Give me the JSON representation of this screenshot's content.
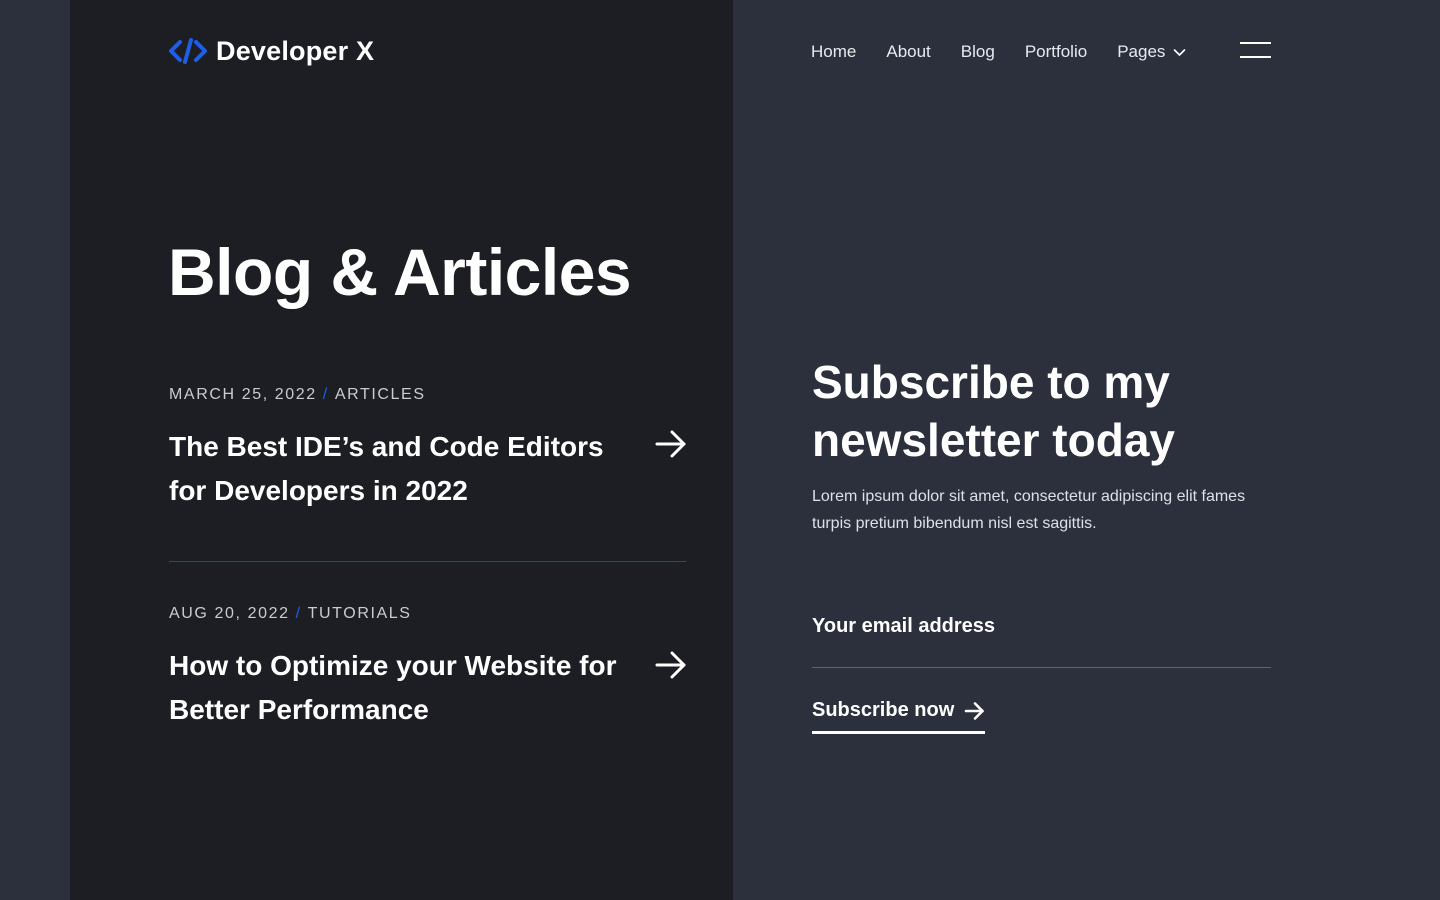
{
  "brand": {
    "name": "Developer X",
    "icon": "code-brackets-icon",
    "accent_color": "#1f5ee8"
  },
  "nav": {
    "items": [
      {
        "label": "Home"
      },
      {
        "label": "About"
      },
      {
        "label": "Blog"
      },
      {
        "label": "Portfolio"
      },
      {
        "label": "Pages"
      }
    ],
    "menu_icon": "hamburger-menu-icon"
  },
  "page": {
    "title": "Blog & Articles"
  },
  "articles": [
    {
      "date": "MARCH 25, 2022",
      "separator": "/",
      "category": "ARTICLES",
      "title": "The Best IDE’s and Code Editors for Developers in 2022"
    },
    {
      "date": "AUG 20, 2022",
      "separator": "/",
      "category": "TUTORIALS",
      "title": "How to Optimize your Website for Better Performance"
    }
  ],
  "newsletter": {
    "title": "Subscribe to my newsletter today",
    "description": "Lorem ipsum dolor sit amet, consectetur adipiscing elit fames turpis pretium bibendum nisl est sagittis.",
    "email_placeholder": "Your email address",
    "button_label": "Subscribe now"
  },
  "colors": {
    "left_bg": "#1c1e23",
    "right_bg": "#2b303c",
    "text": "#ffffff"
  }
}
